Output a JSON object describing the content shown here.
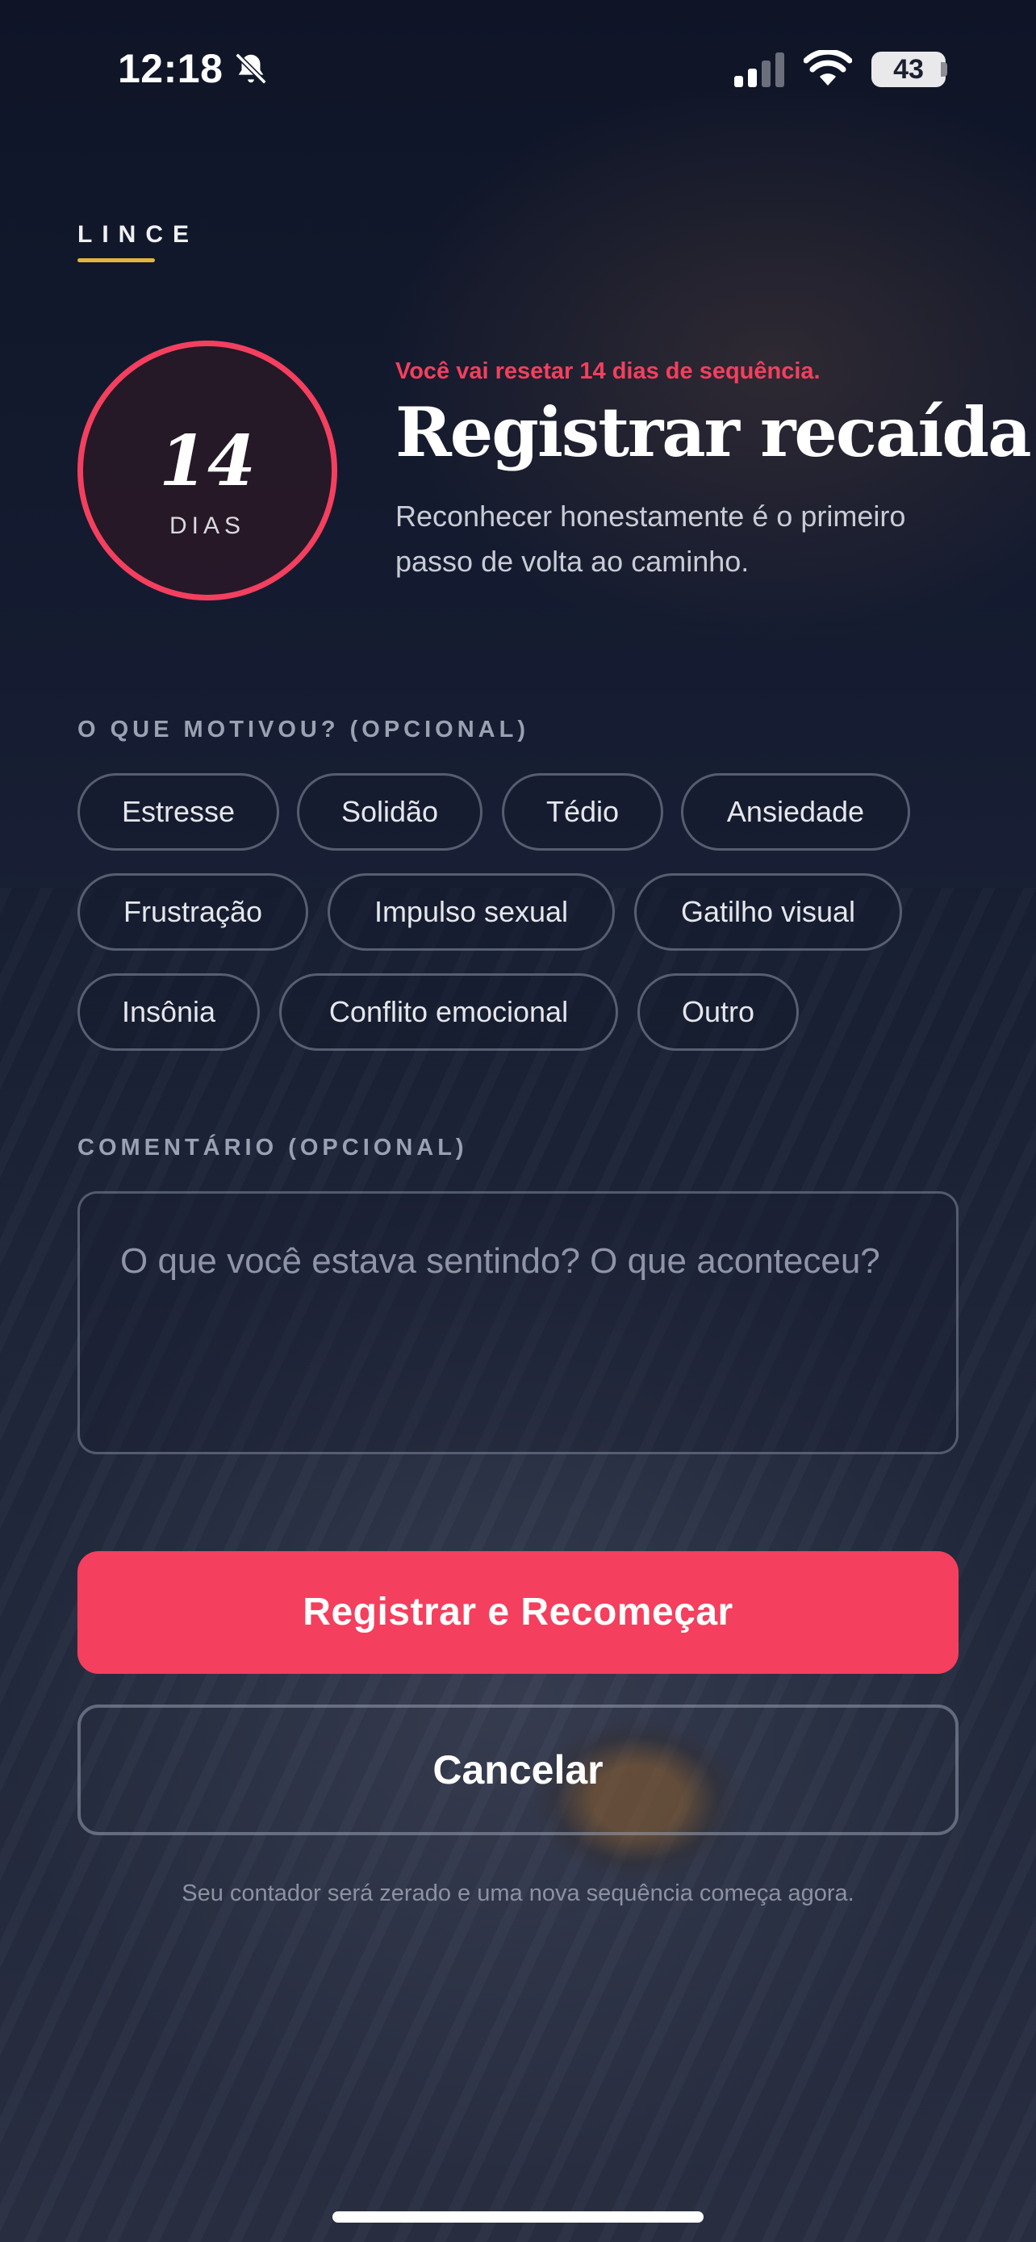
{
  "status_bar": {
    "time": "12:18",
    "battery": "43",
    "icons": [
      "bell-slash-icon",
      "cellular-signal-icon",
      "wifi-icon",
      "battery-icon"
    ]
  },
  "brand": {
    "name": "LINCE",
    "accent": "#e2b53c"
  },
  "counter": {
    "value": "14",
    "unit": "DIAS",
    "ring_color": "#f43f5e"
  },
  "header": {
    "warning": "Você vai resetar 14 dias de sequência.",
    "title": "Registrar recaída",
    "subtitle": "Reconhecer honestamente é o primeiro passo de volta ao caminho."
  },
  "motives": {
    "label": "O QUE MOTIVOU? (OPCIONAL)",
    "options": [
      "Estresse",
      "Solidão",
      "Tédio",
      "Ansiedade",
      "Frustração",
      "Impulso sexual",
      "Gatilho visual",
      "Insônia",
      "Conflito emocional",
      "Outro"
    ]
  },
  "comment": {
    "label": "COMENTÁRIO (OPCIONAL)",
    "placeholder": "O que você estava sentindo? O que aconteceu?",
    "value": ""
  },
  "actions": {
    "primary": "Registrar e Recomeçar",
    "secondary": "Cancelar",
    "footnote": "Seu contador será zerado e uma nova sequência começa agora.",
    "primary_color": "#f43f5e"
  }
}
